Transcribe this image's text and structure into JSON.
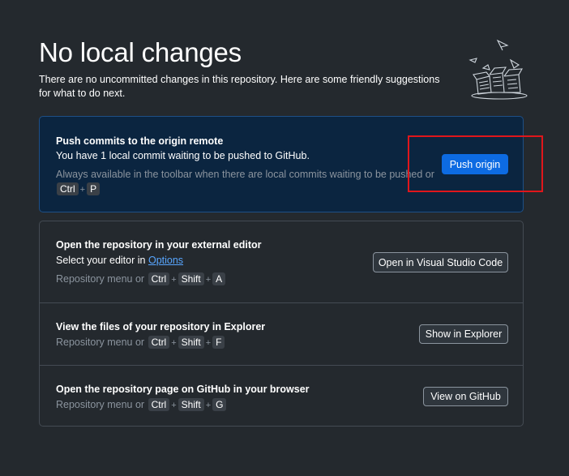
{
  "header": {
    "title": "No local changes",
    "subtitle": "There are no uncommitted changes in this repository. Here are some friendly suggestions for what to do next."
  },
  "push_card": {
    "title": "Push commits to the origin remote",
    "description": "You have 1 local commit waiting to be pushed to GitHub.",
    "hint": "Always available in the toolbar when there are local commits waiting to be pushed or",
    "shortcut": [
      "Ctrl",
      "P"
    ],
    "button_label": "Push origin"
  },
  "editor_row": {
    "title": "Open the repository in your external editor",
    "description_prefix": "Select your editor in",
    "link_label": "Options",
    "hint": "Repository menu or",
    "shortcut": [
      "Ctrl",
      "Shift",
      "A"
    ],
    "button_label": "Open in Visual Studio Code"
  },
  "explorer_row": {
    "title": "View the files of your repository in Explorer",
    "hint": "Repository menu or",
    "shortcut": [
      "Ctrl",
      "Shift",
      "F"
    ],
    "button_label": "Show in Explorer"
  },
  "github_row": {
    "title": "Open the repository page on GitHub in your browser",
    "hint": "Repository menu or",
    "shortcut": [
      "Ctrl",
      "Shift",
      "G"
    ],
    "button_label": "View on GitHub"
  },
  "plus_sign": "+",
  "colors": {
    "background": "#24292e",
    "primary_card_bg": "#0b2540",
    "accent_blue": "#0d6be2",
    "highlight_red": "#e0161b"
  }
}
